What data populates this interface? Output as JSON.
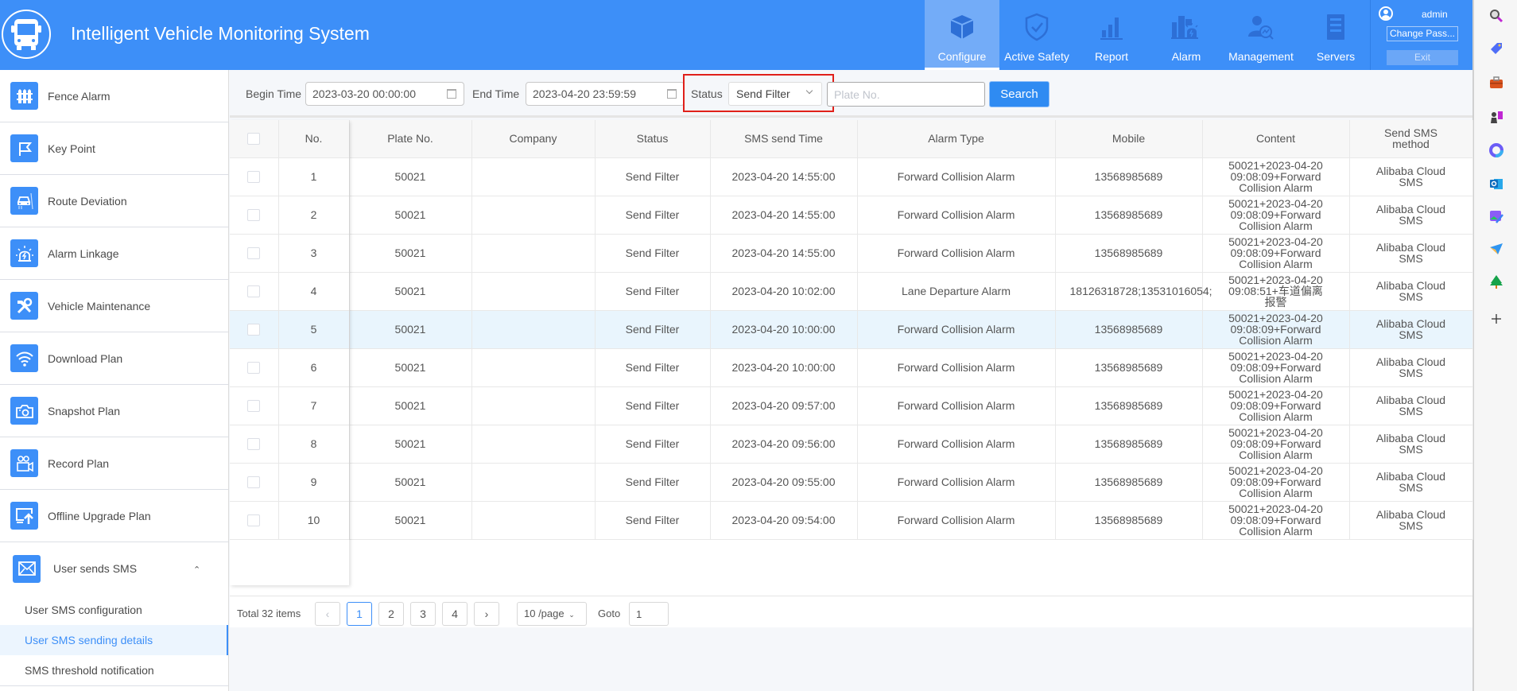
{
  "header": {
    "app_title": "Intelligent Vehicle Monitoring System",
    "nav": [
      {
        "label": "Configure",
        "icon": "cube-icon",
        "active": true
      },
      {
        "label": "Active Safety",
        "icon": "shield-check-icon"
      },
      {
        "label": "Report",
        "icon": "bar-chart-icon"
      },
      {
        "label": "Alarm",
        "icon": "alarm-light-icon"
      },
      {
        "label": "Management",
        "icon": "user-chart-icon"
      },
      {
        "label": "Servers",
        "icon": "server-icon"
      }
    ],
    "user": {
      "name": "admin",
      "change_password": "Change Pass...",
      "exit": "Exit"
    }
  },
  "sidebar": {
    "items": [
      {
        "label": "Fence Alarm",
        "icon": "fence-icon"
      },
      {
        "label": "Key Point",
        "icon": "flag-icon"
      },
      {
        "label": "Route Deviation",
        "icon": "car-road-icon"
      },
      {
        "label": "Alarm Linkage",
        "icon": "siren-icon"
      },
      {
        "label": "Vehicle Maintenance",
        "icon": "tools-icon"
      },
      {
        "label": "Download Plan",
        "icon": "wifi-icon"
      },
      {
        "label": "Snapshot Plan",
        "icon": "camera-icon"
      },
      {
        "label": "Record Plan",
        "icon": "video-camera-icon"
      },
      {
        "label": "Offline Upgrade Plan",
        "icon": "upload-screen-icon"
      }
    ],
    "expanded": {
      "label": "User sends SMS",
      "icon": "mail-icon",
      "children": [
        {
          "label": "User SMS configuration"
        },
        {
          "label": "User SMS sending details",
          "active": true
        },
        {
          "label": "SMS threshold notification"
        }
      ]
    }
  },
  "filters": {
    "begin_time_label": "Begin Time",
    "begin_time": "2023-03-20 00:00:00",
    "end_time_label": "End Time",
    "end_time": "2023-04-20 23:59:59",
    "status_label": "Status",
    "status_value": "Send Filter",
    "plate_placeholder": "Plate No.",
    "search_label": "Search"
  },
  "table": {
    "columns": [
      "No.",
      "Plate No.",
      "Company",
      "Status",
      "SMS send Time",
      "Alarm Type",
      "Mobile",
      "Content",
      "Send SMS method"
    ],
    "rows": [
      {
        "no": "1",
        "plate": "50021",
        "company": "",
        "status": "Send Filter",
        "time": "2023-04-20 14:55:00",
        "alarm": "Forward Collision Alarm",
        "mobile": "13568985689",
        "content": "50021+2023-04-20 09:08:09+Forward Collision Alarm",
        "method": "Alibaba Cloud SMS"
      },
      {
        "no": "2",
        "plate": "50021",
        "company": "",
        "status": "Send Filter",
        "time": "2023-04-20 14:55:00",
        "alarm": "Forward Collision Alarm",
        "mobile": "13568985689",
        "content": "50021+2023-04-20 09:08:09+Forward Collision Alarm",
        "method": "Alibaba Cloud SMS"
      },
      {
        "no": "3",
        "plate": "50021",
        "company": "",
        "status": "Send Filter",
        "time": "2023-04-20 14:55:00",
        "alarm": "Forward Collision Alarm",
        "mobile": "13568985689",
        "content": "50021+2023-04-20 09:08:09+Forward Collision Alarm",
        "method": "Alibaba Cloud SMS"
      },
      {
        "no": "4",
        "plate": "50021",
        "company": "",
        "status": "Send Filter",
        "time": "2023-04-20 10:02:00",
        "alarm": "Lane Departure Alarm",
        "mobile": "18126318728;13531016054;",
        "content": "50021+2023-04-20 09:08:51+车道偏离报警",
        "method": "Alibaba Cloud SMS"
      },
      {
        "no": "5",
        "plate": "50021",
        "company": "",
        "status": "Send Filter",
        "time": "2023-04-20 10:00:00",
        "alarm": "Forward Collision Alarm",
        "mobile": "13568985689",
        "content": "50021+2023-04-20 09:08:09+Forward Collision Alarm",
        "method": "Alibaba Cloud SMS",
        "highlighted": true
      },
      {
        "no": "6",
        "plate": "50021",
        "company": "",
        "status": "Send Filter",
        "time": "2023-04-20 10:00:00",
        "alarm": "Forward Collision Alarm",
        "mobile": "13568985689",
        "content": "50021+2023-04-20 09:08:09+Forward Collision Alarm",
        "method": "Alibaba Cloud SMS"
      },
      {
        "no": "7",
        "plate": "50021",
        "company": "",
        "status": "Send Filter",
        "time": "2023-04-20 09:57:00",
        "alarm": "Forward Collision Alarm",
        "mobile": "13568985689",
        "content": "50021+2023-04-20 09:08:09+Forward Collision Alarm",
        "method": "Alibaba Cloud SMS"
      },
      {
        "no": "8",
        "plate": "50021",
        "company": "",
        "status": "Send Filter",
        "time": "2023-04-20 09:56:00",
        "alarm": "Forward Collision Alarm",
        "mobile": "13568985689",
        "content": "50021+2023-04-20 09:08:09+Forward Collision Alarm",
        "method": "Alibaba Cloud SMS"
      },
      {
        "no": "9",
        "plate": "50021",
        "company": "",
        "status": "Send Filter",
        "time": "2023-04-20 09:55:00",
        "alarm": "Forward Collision Alarm",
        "mobile": "13568985689",
        "content": "50021+2023-04-20 09:08:09+Forward Collision Alarm",
        "method": "Alibaba Cloud SMS"
      },
      {
        "no": "10",
        "plate": "50021",
        "company": "",
        "status": "Send Filter",
        "time": "2023-04-20 09:54:00",
        "alarm": "Forward Collision Alarm",
        "mobile": "13568985689",
        "content": "50021+2023-04-20 09:08:09+Forward Collision Alarm",
        "method": "Alibaba Cloud SMS"
      }
    ]
  },
  "pagination": {
    "total": "Total 32 items",
    "pages": [
      "1",
      "2",
      "3",
      "4"
    ],
    "current": "1",
    "prev": "‹",
    "next": "›",
    "page_size": "10 /page",
    "goto_label": "Goto",
    "goto_value": "1"
  },
  "edge_bar": {
    "icons": [
      "search-icon",
      "tag-icon",
      "toolbox-icon",
      "chess-icon",
      "copilot-icon",
      "outlook-icon",
      "image-editor-icon",
      "send-icon",
      "tree-icon",
      "plus-icon"
    ]
  },
  "colors": {
    "brand": "#3d8ff8",
    "highlight_border": "#e0201a",
    "row_highlight": "#e9f5fd"
  }
}
